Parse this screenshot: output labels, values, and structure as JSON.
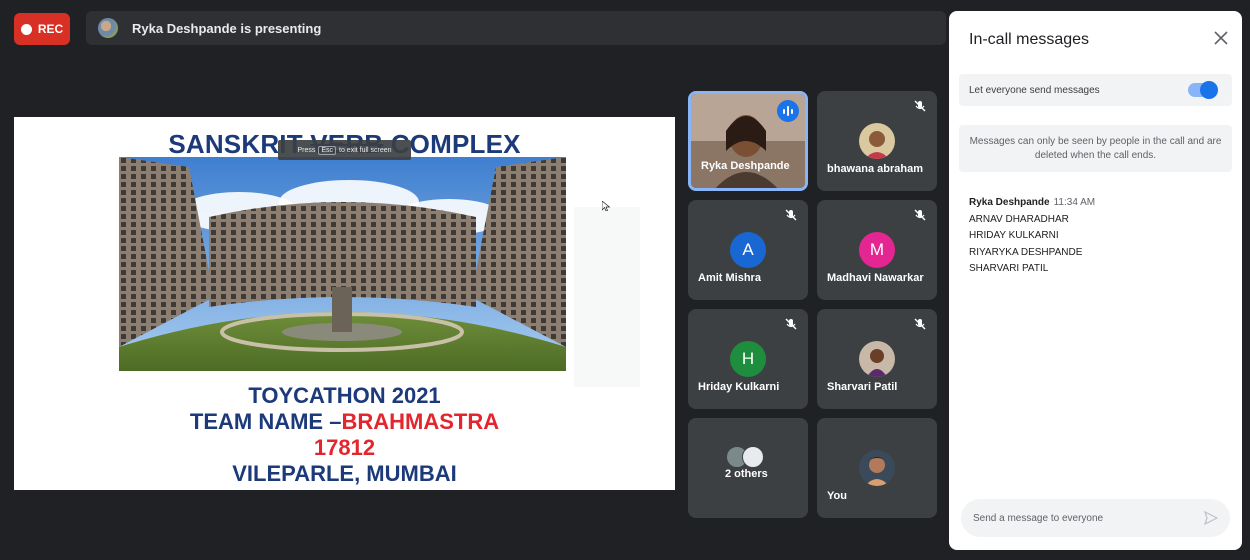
{
  "topbar": {
    "rec_label": "REC",
    "presenting_text": "Ryka Deshpande is presenting"
  },
  "slide": {
    "title_prefix": "SANSKRIT ",
    "title_struck": "VERB",
    "title_suffix": " COMPLEX",
    "esc_press": "Press",
    "esc_key": "Esc",
    "esc_suffix": "to exit full screen",
    "line1": "TOYCATHON 2021",
    "line2_prefix": "TEAM NAME –",
    "line2_red": "BRAHMASTRA",
    "line3": "17812",
    "line4": "VILEPARLE, MUMBAI"
  },
  "participants": [
    {
      "name": "Ryka Deshpande",
      "speaking": true
    },
    {
      "name": "bhawana abraham",
      "muted": true
    },
    {
      "name": "Amit Mishra",
      "initial": "A",
      "color": "#1967d2",
      "muted": true
    },
    {
      "name": "Madhavi Nawarkar",
      "initial": "M",
      "color": "#e52592",
      "muted": true
    },
    {
      "name": "Hriday Kulkarni",
      "initial": "H",
      "color": "#1e8e3e",
      "muted": true
    },
    {
      "name": "Sharvari Patil",
      "muted": true
    },
    {
      "name": "2 others"
    },
    {
      "name": "You"
    }
  ],
  "panel": {
    "title": "In-call messages",
    "toggle_label": "Let everyone send messages",
    "toggle_on": true,
    "notice": "Messages can only be seen by people in the call and are deleted when the call ends.",
    "message": {
      "sender": "Ryka Deshpande",
      "time": "11:34 AM",
      "lines": [
        "ARNAV DHARADHAR",
        "HRIDAY KULKARNI",
        "RIYARYKA DESHPANDE",
        "SHARVARI PATIL"
      ]
    },
    "compose_placeholder": "Send a message to everyone"
  },
  "colors": {
    "accent": "#1a73e8",
    "rec": "#d93025",
    "background": "#202124",
    "tile": "#3c4043",
    "slide_blue": "#1c3a7a",
    "slide_red": "#e3262e"
  }
}
